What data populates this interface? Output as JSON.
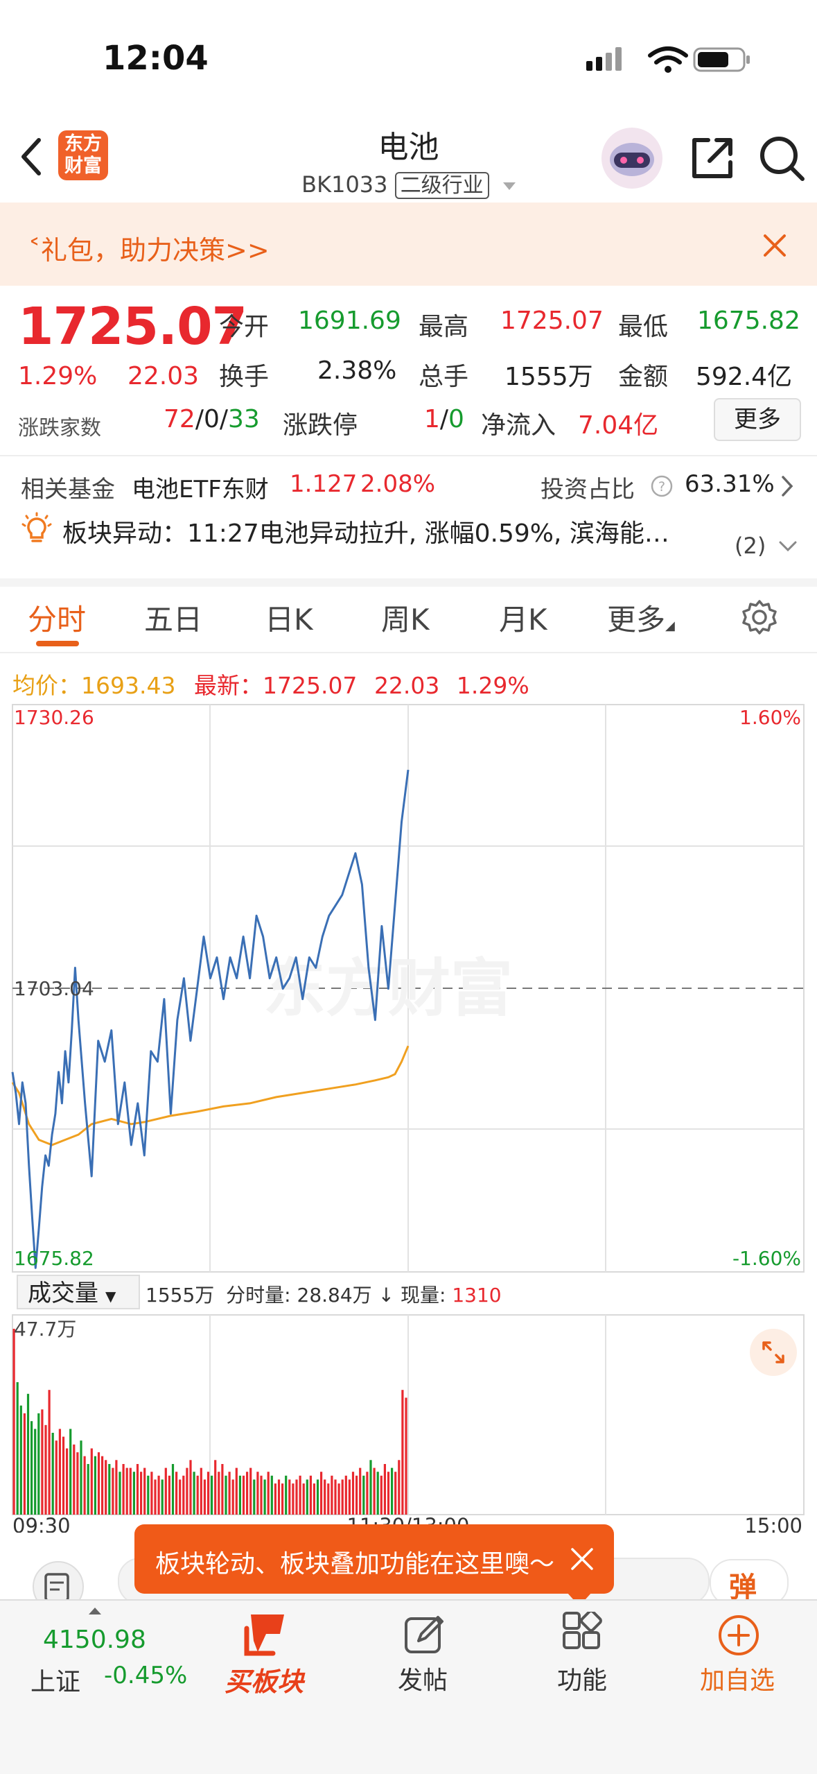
{
  "status_bar": {
    "time": "12:04"
  },
  "header": {
    "logo_text_line1": "东方",
    "logo_text_line2": "财富",
    "title": "电池",
    "code": "BK1033",
    "category": "二级行业"
  },
  "banner": {
    "text": "˂礼包，助力决策>>"
  },
  "quote": {
    "price": "1725.07",
    "change_pct": "1.29%",
    "change": "22.03",
    "open_label": "今开",
    "open": "1691.69",
    "high_label": "最高",
    "high": "1725.07",
    "low_label": "最低",
    "low": "1675.82",
    "turnover_label": "换手",
    "turnover": "2.38%",
    "volume_label": "总手",
    "volume": "1555万",
    "amount_label": "金额",
    "amount": "592.4亿",
    "breadth_label": "涨跌家数",
    "breadth_up": "72",
    "breadth_flat": "0",
    "breadth_down": "33",
    "limit_label": "涨跌停",
    "limit_up": "1",
    "limit_down": "0",
    "inflow_label": "净流入",
    "inflow": "7.04亿",
    "more_label": "更多"
  },
  "fund": {
    "label": "相关基金",
    "name": "电池ETF东财",
    "price": "1.127",
    "pct": "2.08%",
    "ratio_label": "投资占比",
    "ratio": "63.31%"
  },
  "alert": {
    "text": "板块异动：11:27电池异动拉升, 涨幅0.59%, 滨海能…",
    "count": "(2)"
  },
  "tabs": [
    "分时",
    "五日",
    "日K",
    "周K",
    "月K",
    "更多"
  ],
  "info_line": {
    "avg_label": "均价：",
    "avg": "1693.43",
    "latest_label": "最新：",
    "latest": "1725.07",
    "change": "22.03",
    "pct": "1.29%"
  },
  "watermark": "东方财富",
  "vol_bar": {
    "select": "成交量",
    "total": "1555万",
    "tick_label": "分时量:",
    "tick": "28.84万",
    "now_label": "现量:",
    "now": "1310"
  },
  "toast": {
    "text": "板块轮动、板块叠加功能在这里噢～"
  },
  "bottom_nav": {
    "index_value": "4150.98",
    "index_name": "上证",
    "index_pct": "-0.45%",
    "buy_label": "买板块",
    "post_label": "发帖",
    "func_label": "功能",
    "add_label": "加自选"
  },
  "colors": {
    "up": "#e8282e",
    "down": "#169b2e",
    "accent": "#e8601a",
    "price_line": "#3a6fb5",
    "avg_line": "#f0a020"
  },
  "chart_data": {
    "type": "line",
    "title": "",
    "ylim": [
      1675.82,
      1730.26
    ],
    "prev_close": 1703.04,
    "y_labels": {
      "top": "1730.26",
      "mid": "1703.04",
      "bottom": "1675.82",
      "top_pct": "1.60%",
      "bottom_pct": "-1.60%"
    },
    "x_labels": [
      "09:30",
      "11:30/13:00",
      "15:00"
    ],
    "vol_max_label": "47.7万",
    "total_minutes": 240,
    "series": [
      {
        "name": "最新",
        "x": [
          0,
          1,
          2,
          3,
          4,
          5,
          6,
          7,
          8,
          9,
          10,
          11,
          12,
          13,
          14,
          15,
          16,
          17,
          18,
          19,
          20,
          22,
          24,
          26,
          28,
          30,
          32,
          34,
          36,
          38,
          40,
          42,
          44,
          46,
          48,
          50,
          52,
          54,
          56,
          58,
          60,
          62,
          64,
          66,
          68,
          70,
          72,
          74,
          76,
          78,
          80,
          82,
          84,
          86,
          88,
          90,
          92,
          94,
          96,
          98,
          100,
          102,
          104,
          106,
          108,
          110,
          112,
          114,
          116,
          118,
          120
        ],
        "values": [
          1695,
          1693,
          1690,
          1694,
          1692,
          1686,
          1681,
          1676.2,
          1680,
          1684,
          1687,
          1686,
          1689,
          1691,
          1695,
          1692,
          1697,
          1694,
          1699,
          1705,
          1700,
          1692,
          1685,
          1698,
          1696,
          1699,
          1690,
          1694,
          1688,
          1692,
          1687,
          1697,
          1696,
          1702,
          1691,
          1700,
          1704,
          1698,
          1703,
          1708,
          1704,
          1706,
          1702,
          1706,
          1704,
          1708,
          1704,
          1710,
          1708,
          1704,
          1706,
          1703,
          1704,
          1706,
          1702,
          1706,
          1705,
          1708,
          1710,
          1711,
          1712,
          1714,
          1716,
          1713,
          1705,
          1700,
          1709,
          1703,
          1711,
          1719,
          1724
        ]
      },
      {
        "name": "均价",
        "x": [
          0,
          2,
          5,
          8,
          12,
          16,
          20,
          24,
          30,
          36,
          40,
          48,
          56,
          64,
          72,
          80,
          88,
          96,
          104,
          110,
          114,
          116,
          118,
          120
        ],
        "values": [
          1694,
          1693,
          1690,
          1688.5,
          1688,
          1688.5,
          1689,
          1690,
          1690.5,
          1690,
          1690.2,
          1690.8,
          1691.2,
          1691.7,
          1692,
          1692.6,
          1693,
          1693.4,
          1693.8,
          1694.2,
          1694.5,
          1694.8,
          1696,
          1697.5
        ]
      }
    ],
    "volume": [
      47.7,
      34,
      28,
      26,
      31,
      24,
      22,
      26,
      27,
      23,
      32,
      21,
      19,
      22,
      20,
      17,
      22,
      18,
      16,
      19,
      15,
      13,
      17,
      15,
      16,
      15,
      14,
      13,
      12,
      14,
      11,
      13,
      12,
      12,
      11,
      13,
      11,
      12,
      10,
      11,
      9,
      10,
      9,
      12,
      10,
      13,
      11,
      9,
      10,
      12,
      14,
      11,
      10,
      12,
      9,
      11,
      10,
      14,
      11,
      13,
      10,
      11,
      9,
      12,
      10,
      10,
      11,
      12,
      9,
      11,
      10,
      9,
      11,
      10,
      8,
      9,
      8,
      10,
      9,
      8,
      9,
      10,
      8,
      9,
      10,
      8,
      9,
      11,
      9,
      8,
      10,
      9,
      8,
      9,
      10,
      9,
      11,
      10,
      12,
      10,
      11,
      14,
      12,
      11,
      10,
      13,
      11,
      12,
      11,
      14,
      32,
      30
    ]
  }
}
